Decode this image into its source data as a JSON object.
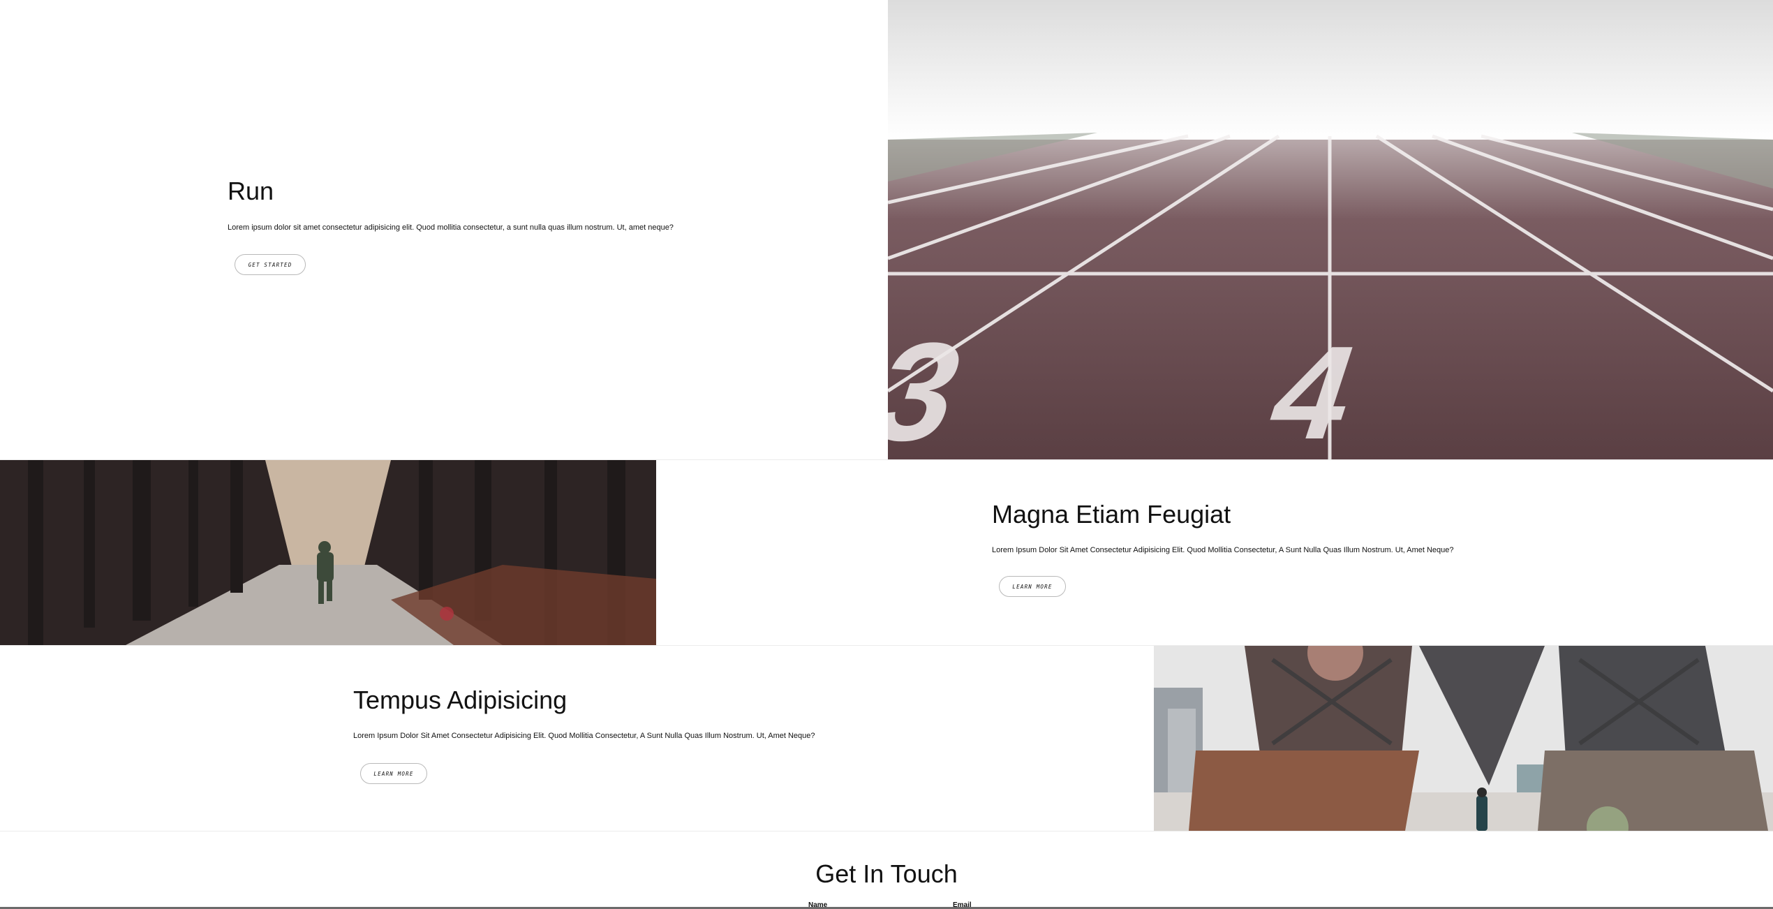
{
  "run": {
    "title": "Run",
    "text": "Lorem ipsum dolor sit amet consectetur adipisicing elit. Quod mollitia consectetur, a sunt nulla quas illum nostrum. Ut, amet neque?",
    "button": "Get Started"
  },
  "magna": {
    "title": "Magna Etiam Feugiat",
    "text": "Lorem Ipsum Dolor Sit Amet Consectetur Adipisicing Elit. Quod Mollitia Consectetur, A Sunt Nulla Quas Illum Nostrum. Ut, Amet Neque?",
    "button": "Learn More"
  },
  "tempus": {
    "title": "Tempus Adipisicing",
    "text": "Lorem Ipsum Dolor Sit Amet Consectetur Adipisicing Elit. Quod Mollitia Consectetur, A Sunt Nulla Quas Illum Nostrum. Ut, Amet Neque?",
    "button": "Learn More"
  },
  "contact": {
    "title": "Get In Touch",
    "name_label": "Name",
    "email_label": "Email"
  },
  "images": {
    "track": "running-track-image",
    "forest": "forest-runner-image",
    "bridge": "bridge-runner-image"
  },
  "colors": {
    "track_surface": "#5d4347",
    "forest_dark": "#2d2424",
    "bridge_sky": "#e6e6e6"
  }
}
